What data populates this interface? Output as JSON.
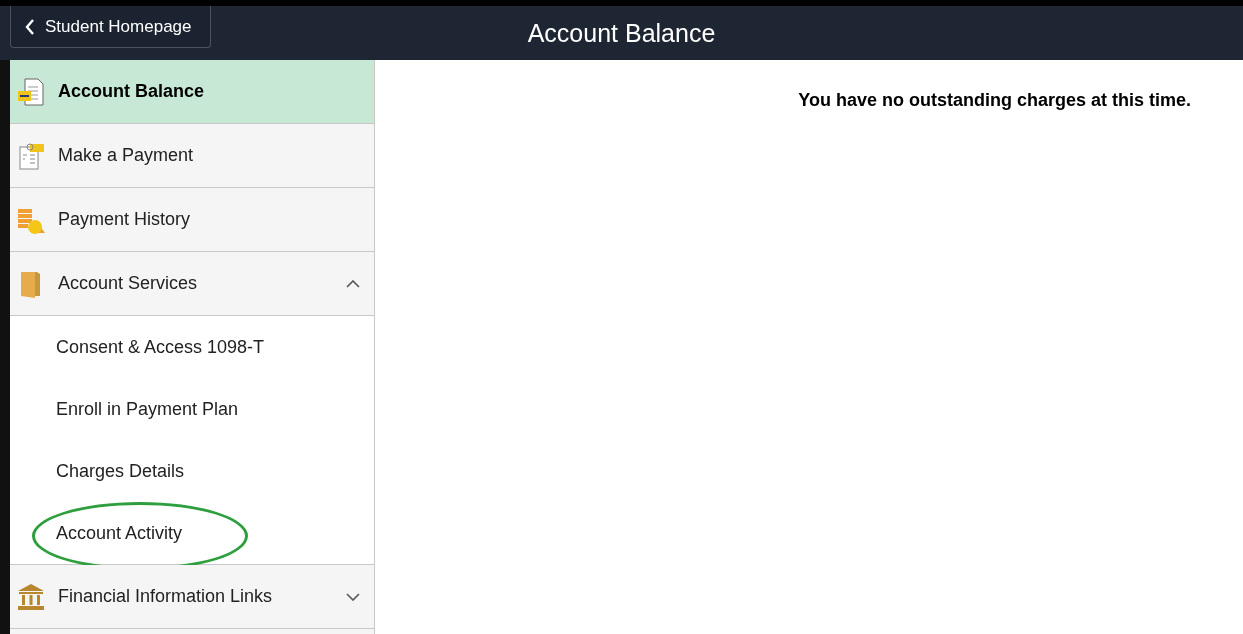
{
  "header": {
    "back_button": "Student Homepage",
    "title": "Account Balance"
  },
  "sidebar": {
    "items": [
      {
        "label": "Account Balance",
        "selected": true
      },
      {
        "label": "Make a Payment",
        "selected": false
      },
      {
        "label": "Payment History",
        "selected": false
      },
      {
        "label": "Account Services",
        "selected": false,
        "expanded": true,
        "children": [
          {
            "label": "Consent & Access 1098-T",
            "selected": false,
            "circled": false
          },
          {
            "label": "Enroll in Payment Plan",
            "selected": false,
            "circled": false
          },
          {
            "label": "Charges Details",
            "selected": false,
            "circled": false
          },
          {
            "label": "Account Activity",
            "selected": false,
            "circled": true
          }
        ]
      },
      {
        "label": "Financial Information Links",
        "selected": false,
        "expanded": false
      }
    ]
  },
  "content": {
    "message": "You have no outstanding charges at this time."
  }
}
